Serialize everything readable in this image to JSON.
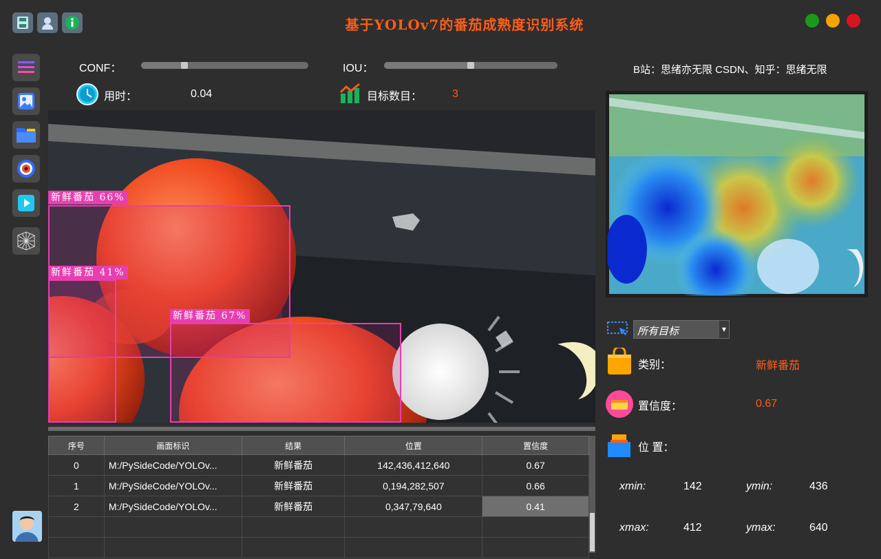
{
  "window": {
    "title": "基于YOLOv7的番茄成熟度识别系统",
    "controls": {
      "green": "#1a9a1a",
      "yellow": "#f5a300",
      "red": "#d9141e"
    }
  },
  "titlebar_icons": [
    "save-icon",
    "user-icon",
    "info-icon"
  ],
  "sidebar": [
    "menu-icon",
    "image-icon",
    "folder-icon",
    "camera-icon",
    "video-icon",
    "model-icon"
  ],
  "params": {
    "conf_label": "CONF：",
    "conf_value": 0.25,
    "iou_label": "IOU：",
    "iou_value": 0.5,
    "time_label": "用时：",
    "time_value": "0.04",
    "count_label": "目标数目：",
    "count_value": "3"
  },
  "credit": "B站：思绪亦无限  CSDN、知乎：思绪无限",
  "detections": [
    {
      "label": "新鲜番茄  66%"
    },
    {
      "label": "新鲜番茄  41%"
    },
    {
      "label": "新鲜番茄  67%"
    }
  ],
  "table": {
    "headers": [
      "序号",
      "画面标识",
      "结果",
      "位置",
      "置信度"
    ],
    "rows": [
      [
        "0",
        "M:/PySideCode/YOLOv...",
        "新鲜番茄",
        "142,436,412,640",
        "0.67"
      ],
      [
        "1",
        "M:/PySideCode/YOLOv...",
        "新鲜番茄",
        "0,194,282,507",
        "0.66"
      ],
      [
        "2",
        "M:/PySideCode/YOLOv...",
        "新鲜番茄",
        "0,347,79,640",
        "0.41"
      ]
    ]
  },
  "target_select": {
    "value": "所有目标"
  },
  "result": {
    "class_label": "类别：",
    "class_value": "新鲜番茄",
    "conf_label": "置信度：",
    "conf_value": "0.67",
    "pos_label": "位  置：",
    "xmin_label": "xmin:",
    "xmin": "142",
    "ymin_label": "ymin:",
    "ymin": "436",
    "xmax_label": "xmax:",
    "xmax": "412",
    "ymax_label": "ymax:",
    "ymax": "640"
  },
  "colors": {
    "accent": "#ff5c1a",
    "box": "#e83fb0",
    "bg": "#2e2e2e"
  }
}
